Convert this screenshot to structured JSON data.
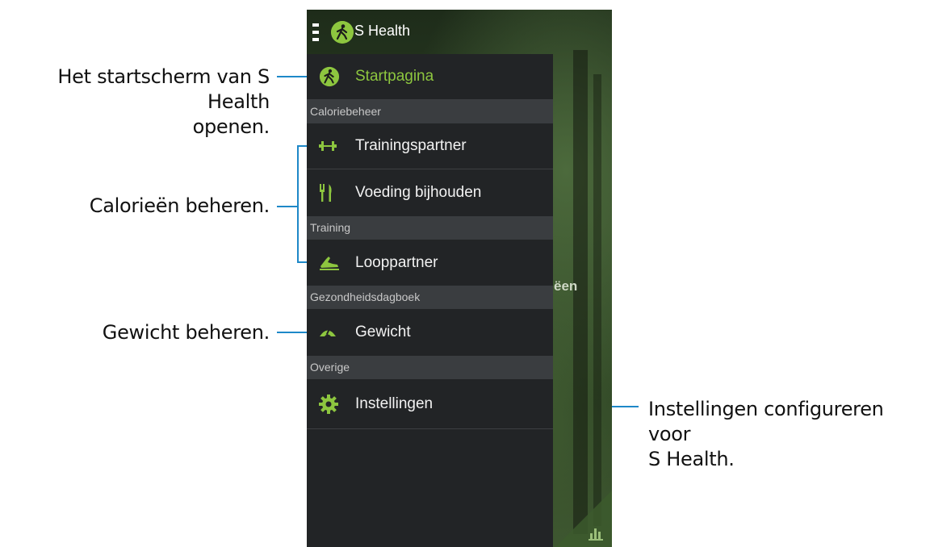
{
  "phone": {
    "app_title": "S Health",
    "background_text": "ëen"
  },
  "drawer": {
    "items": [
      {
        "label": "Startpagina",
        "icon": "walker-icon",
        "active": true
      },
      {
        "label": "Trainingspartner",
        "icon": "dumbbell-icon"
      },
      {
        "label": "Voeding bijhouden",
        "icon": "fork-knife-icon"
      },
      {
        "label": "Looppartner",
        "icon": "running-shoe-icon"
      },
      {
        "label": "Gewicht",
        "icon": "scale-icon"
      },
      {
        "label": "Instellingen",
        "icon": "gear-icon"
      }
    ],
    "sections": [
      "Caloriebeheer",
      "Training",
      "Gezondheidsdagboek",
      "Overige"
    ]
  },
  "callouts": {
    "home": [
      "Het startscherm van S Health",
      "openen."
    ],
    "calories": "Calorieën beheren.",
    "weight": "Gewicht beheren.",
    "settings": [
      "Instellingen configureren voor",
      "S Health."
    ]
  },
  "colors": {
    "accent": "#8dc63f",
    "drawer_bg": "#222426",
    "section_bg": "#3a3d40",
    "callout_line": "#1e88c8"
  }
}
